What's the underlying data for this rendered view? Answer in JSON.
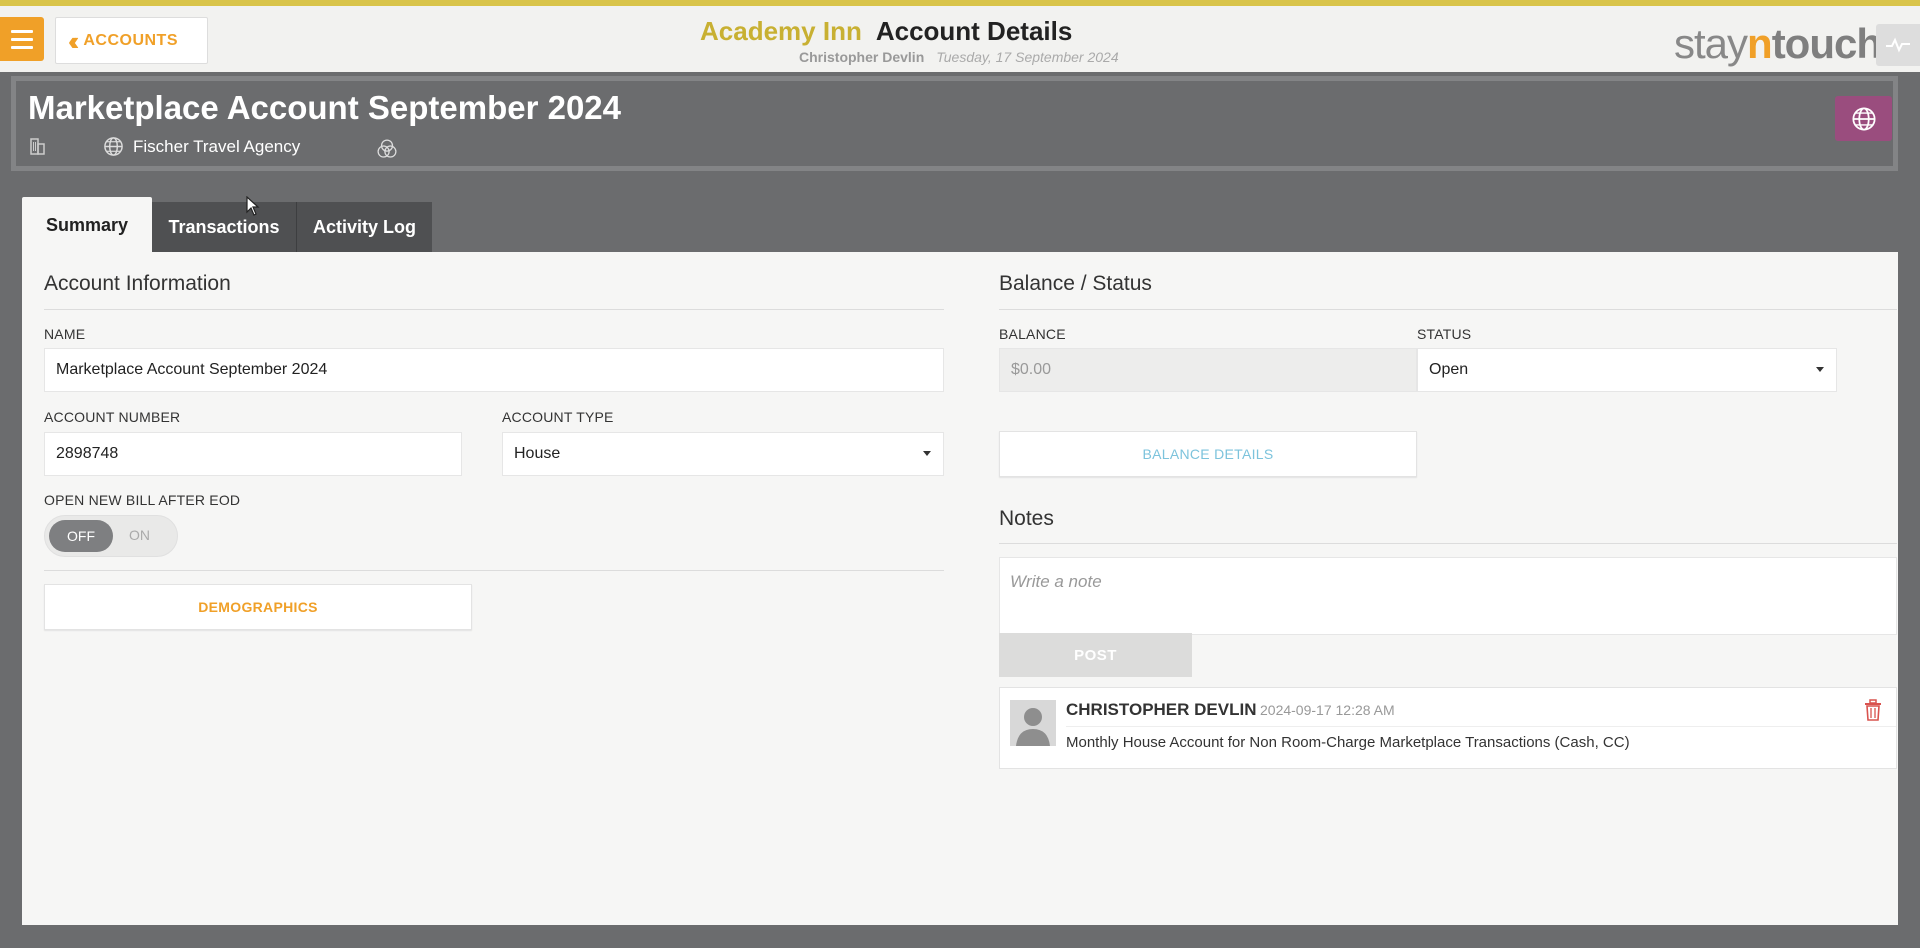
{
  "topbar": {
    "back_label": "ACCOUNTS",
    "hotel_name": "Academy Inn",
    "page_title": "Account Details",
    "user_name": "Christopher Devlin",
    "date": "Tuesday, 17 September 2024",
    "logo_stay": "stay",
    "logo_n": "n",
    "logo_touch": "touch"
  },
  "account": {
    "title": "Marketplace Account September 2024",
    "travel_agent": "Fischer Travel Agency"
  },
  "tabs": [
    {
      "label": "Summary",
      "active": true
    },
    {
      "label": "Transactions",
      "active": false
    },
    {
      "label": "Activity Log",
      "active": false
    }
  ],
  "account_info": {
    "section_title": "Account Information",
    "name_label": "NAME",
    "name_value": "Marketplace Account September 2024",
    "number_label": "ACCOUNT NUMBER",
    "number_value": "2898748",
    "type_label": "ACCOUNT TYPE",
    "type_value": "House",
    "open_bill_label": "OPEN NEW BILL AFTER EOD",
    "toggle_off": "OFF",
    "toggle_on": "ON",
    "demographics_label": "DEMOGRAPHICS"
  },
  "balance": {
    "section_title": "Balance / Status",
    "balance_label": "BALANCE",
    "balance_value": "$0.00",
    "status_label": "STATUS",
    "status_value": "Open",
    "details_label": "BALANCE DETAILS"
  },
  "notes": {
    "section_title": "Notes",
    "placeholder": "Write a note",
    "post_label": "POST",
    "items": [
      {
        "author": "CHRISTOPHER DEVLIN",
        "timestamp": "2024-09-17 12:28 AM",
        "text": "Monthly House Account for Non Room-Charge Marketplace Transactions (Cash, CC)"
      }
    ]
  },
  "colors": {
    "accent_orange": "#f0a028",
    "hotel_gold": "#c8b032",
    "globe_purple": "#9a4d7e",
    "balance_details_blue": "#7cc3dc",
    "trash_red": "#d9534f"
  }
}
